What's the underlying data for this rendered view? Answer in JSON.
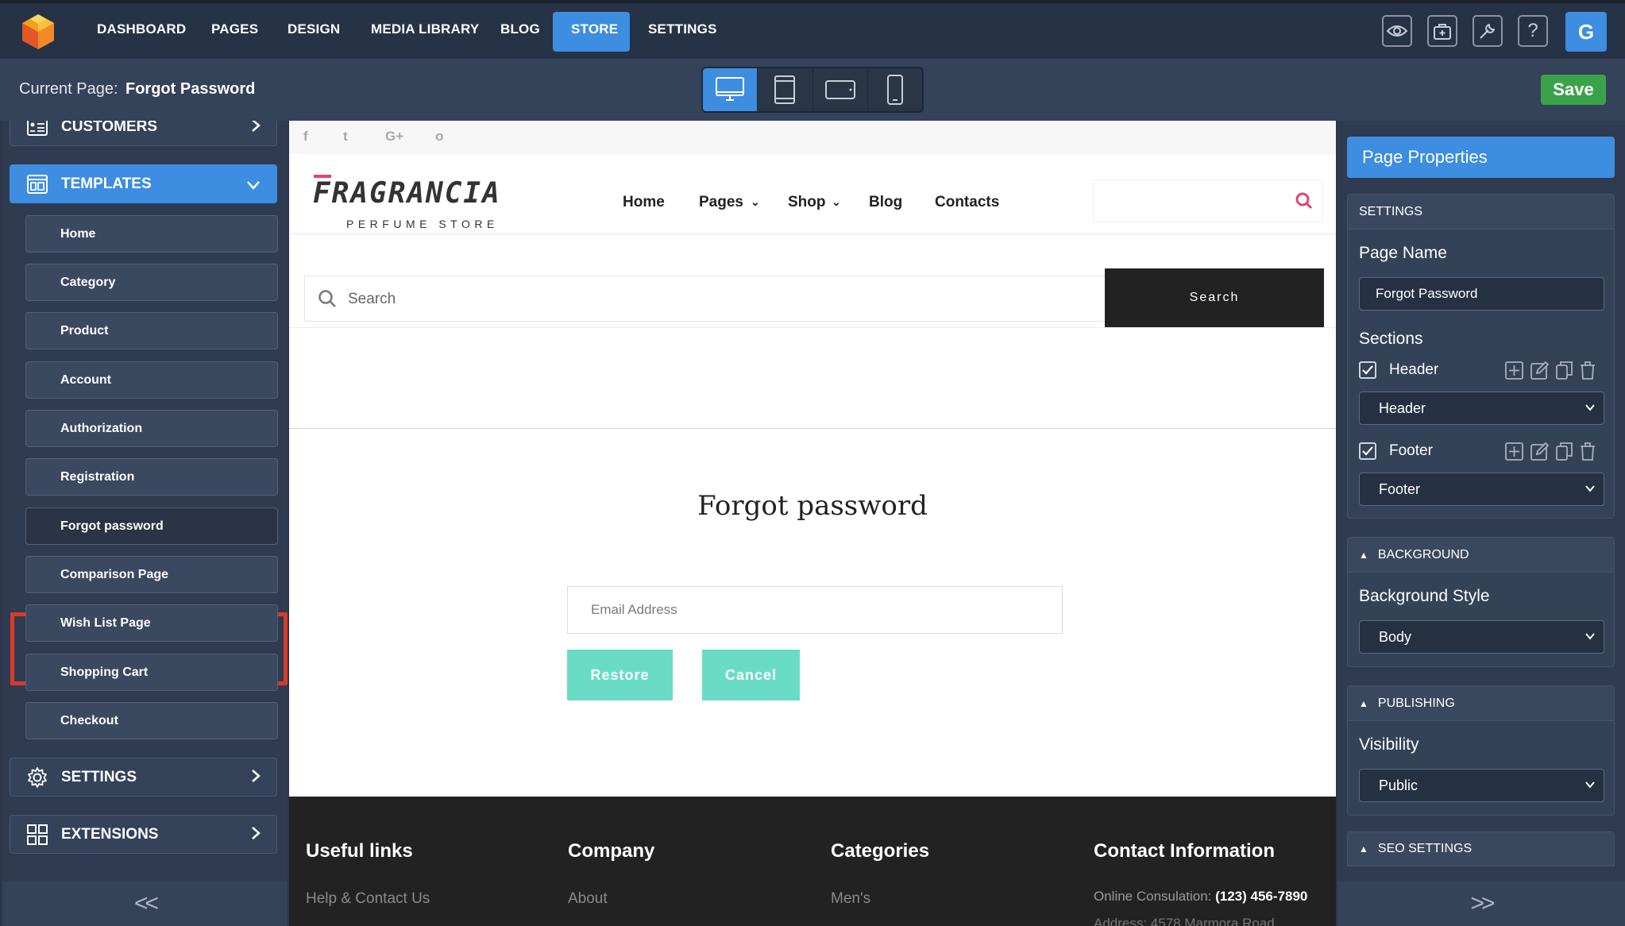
{
  "topnav": {
    "items": [
      "DASHBOARD",
      "PAGES",
      "DESIGN",
      "MEDIA LIBRARY",
      "BLOG",
      "STORE",
      "SETTINGS"
    ],
    "active": "STORE",
    "icons": [
      "eye-icon",
      "bag-icon",
      "wrench-icon",
      "help-icon"
    ],
    "help_glyph": "?",
    "user_initial": "G"
  },
  "subbar": {
    "current_page_label": "Current Page:",
    "current_page_value": "Forgot Password",
    "devices": [
      "desktop-icon",
      "tablet-portrait-icon",
      "tablet-landscape-icon",
      "mobile-icon"
    ],
    "active_device": "desktop-icon",
    "save_label": "Save"
  },
  "sidebar": {
    "customers_label": "CUSTOMERS",
    "templates_label": "TEMPLATES",
    "templates": [
      "Home",
      "Category",
      "Product",
      "Account",
      "Authorization",
      "Registration",
      "Forgot password",
      "Comparison Page",
      "Wish List Page",
      "Shopping Cart",
      "Checkout"
    ],
    "active_template": "Forgot password",
    "settings_label": "SETTINGS",
    "extensions_label": "EXTENSIONS",
    "collapse_glyph": "<<"
  },
  "site": {
    "social": [
      "f",
      "t",
      "G+",
      "o"
    ],
    "brand_name": "FRAGRANCIA",
    "brand_tag": "PERFUME STORE",
    "nav": [
      "Home",
      "Pages",
      "Shop",
      "Blog",
      "Contacts"
    ],
    "dropdown_caret": "⌄",
    "search_placeholder": "Search",
    "search_button": "Search",
    "forgot_title": "Forgot password",
    "email_placeholder": "Email Address",
    "restore_label": "Restore",
    "cancel_label": "Cancel",
    "footer": {
      "headings": [
        "Useful links",
        "Company",
        "Categories",
        "Contact Information"
      ],
      "links": [
        "Help & Contact Us",
        "About",
        "Men's"
      ],
      "contact_label": "Online Consulation:",
      "contact_phone": "(123) 456-7890",
      "address_partial": "Address: 4578 Marmora Road"
    }
  },
  "properties": {
    "title": "Page Properties",
    "settings_head": "SETTINGS",
    "page_name_label": "Page Name",
    "page_name_value": "Forgot Password",
    "sections_label": "Sections",
    "sections": [
      {
        "name": "Header",
        "checked": true,
        "select": "Header"
      },
      {
        "name": "Footer",
        "checked": true,
        "select": "Footer"
      }
    ],
    "background_head": "BACKGROUND",
    "background_style_label": "Background Style",
    "background_style_value": "Body",
    "publishing_head": "PUBLISHING",
    "visibility_label": "Visibility",
    "visibility_value": "Public",
    "seo_head": "SEO SETTINGS",
    "collapse_glyph": ">>"
  },
  "colors": {
    "accent": "#3d8de0",
    "save": "#3aa34a",
    "form_button": "#6adcc6",
    "highlight": "#d93a2b",
    "brand_pink": "#e2456d"
  }
}
